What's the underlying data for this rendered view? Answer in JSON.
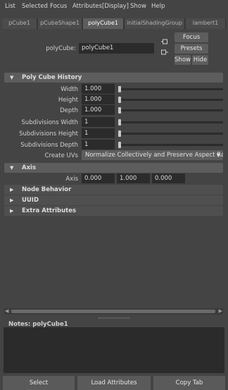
{
  "menu": {
    "items": [
      "List",
      "Selected",
      "Focus",
      "Attributes",
      "Display",
      "Show",
      "Help"
    ]
  },
  "tabs": [
    "pCube1",
    "pCubeShape1",
    "polyCube1",
    "initialShadingGroup",
    "lambert1"
  ],
  "selected_tab": "polyCube1",
  "node": {
    "type_label": "polyCube:",
    "name_value": "polyCube1",
    "focus_label": "Focus",
    "presets_label": "Presets",
    "show_label": "Show",
    "hide_label": "Hide"
  },
  "history_section": {
    "title": "Poly Cube History",
    "width": {
      "label": "Width",
      "value": "1.000"
    },
    "height": {
      "label": "Height",
      "value": "1.000"
    },
    "depth": {
      "label": "Depth",
      "value": "1.000"
    },
    "sub_width": {
      "label": "Subdivisions Width",
      "value": "1"
    },
    "sub_height": {
      "label": "Subdivisions Height",
      "value": "1"
    },
    "sub_depth": {
      "label": "Subdivisions Depth",
      "value": "1"
    },
    "create_uvs": {
      "label": "Create UVs",
      "value": "Normalize Collectively and Preserve Aspect Ratio"
    }
  },
  "axis_section": {
    "title": "Axis",
    "label": "Axis",
    "x": "0.000",
    "y": "1.000",
    "z": "0.000"
  },
  "collapsed_sections": [
    "Node Behavior",
    "UUID",
    "Extra Attributes"
  ],
  "notes": {
    "label": "Notes:  polyCube1"
  },
  "bottom_buttons": {
    "select": "Select",
    "load": "Load Attributes",
    "copy": "Copy Tab"
  },
  "colors": {
    "background": "#444444",
    "field": "#2b2b2b",
    "section_header": "#5d5d5d",
    "display_active": "#7fff3f"
  }
}
